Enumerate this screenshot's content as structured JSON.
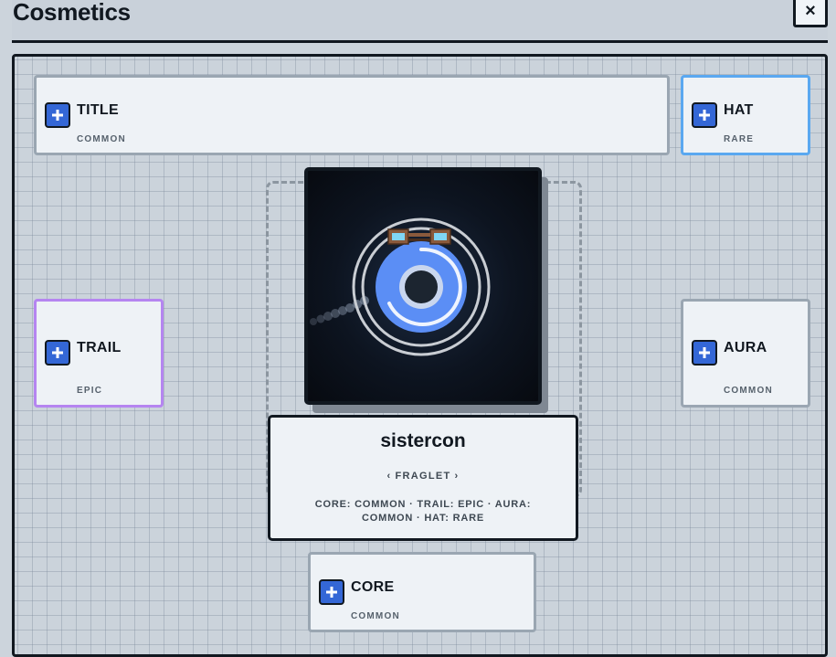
{
  "header": {
    "title": "Cosmetics",
    "close_icon": "×"
  },
  "slots": {
    "title": {
      "label": "TITLE",
      "rarity": "COMMON"
    },
    "hat": {
      "label": "HAT",
      "rarity": "RARE"
    },
    "trail": {
      "label": "TRAIL",
      "rarity": "EPIC"
    },
    "aura": {
      "label": "AURA",
      "rarity": "COMMON"
    },
    "core": {
      "label": "CORE",
      "rarity": "COMMON"
    }
  },
  "preview": {
    "name": "sistercon",
    "kind_prev": "‹",
    "kind": "FRAGLET",
    "kind_next": "›",
    "summary": "CORE: COMMON · TRAIL: EPIC · AURA: COMMON · HAT: RARE"
  },
  "colors": {
    "common": "#9aa6b2",
    "rare": "#5aa8f0",
    "epic": "#b585f0",
    "accent": "#3467d6",
    "core_blue": "#5b8ef5"
  }
}
